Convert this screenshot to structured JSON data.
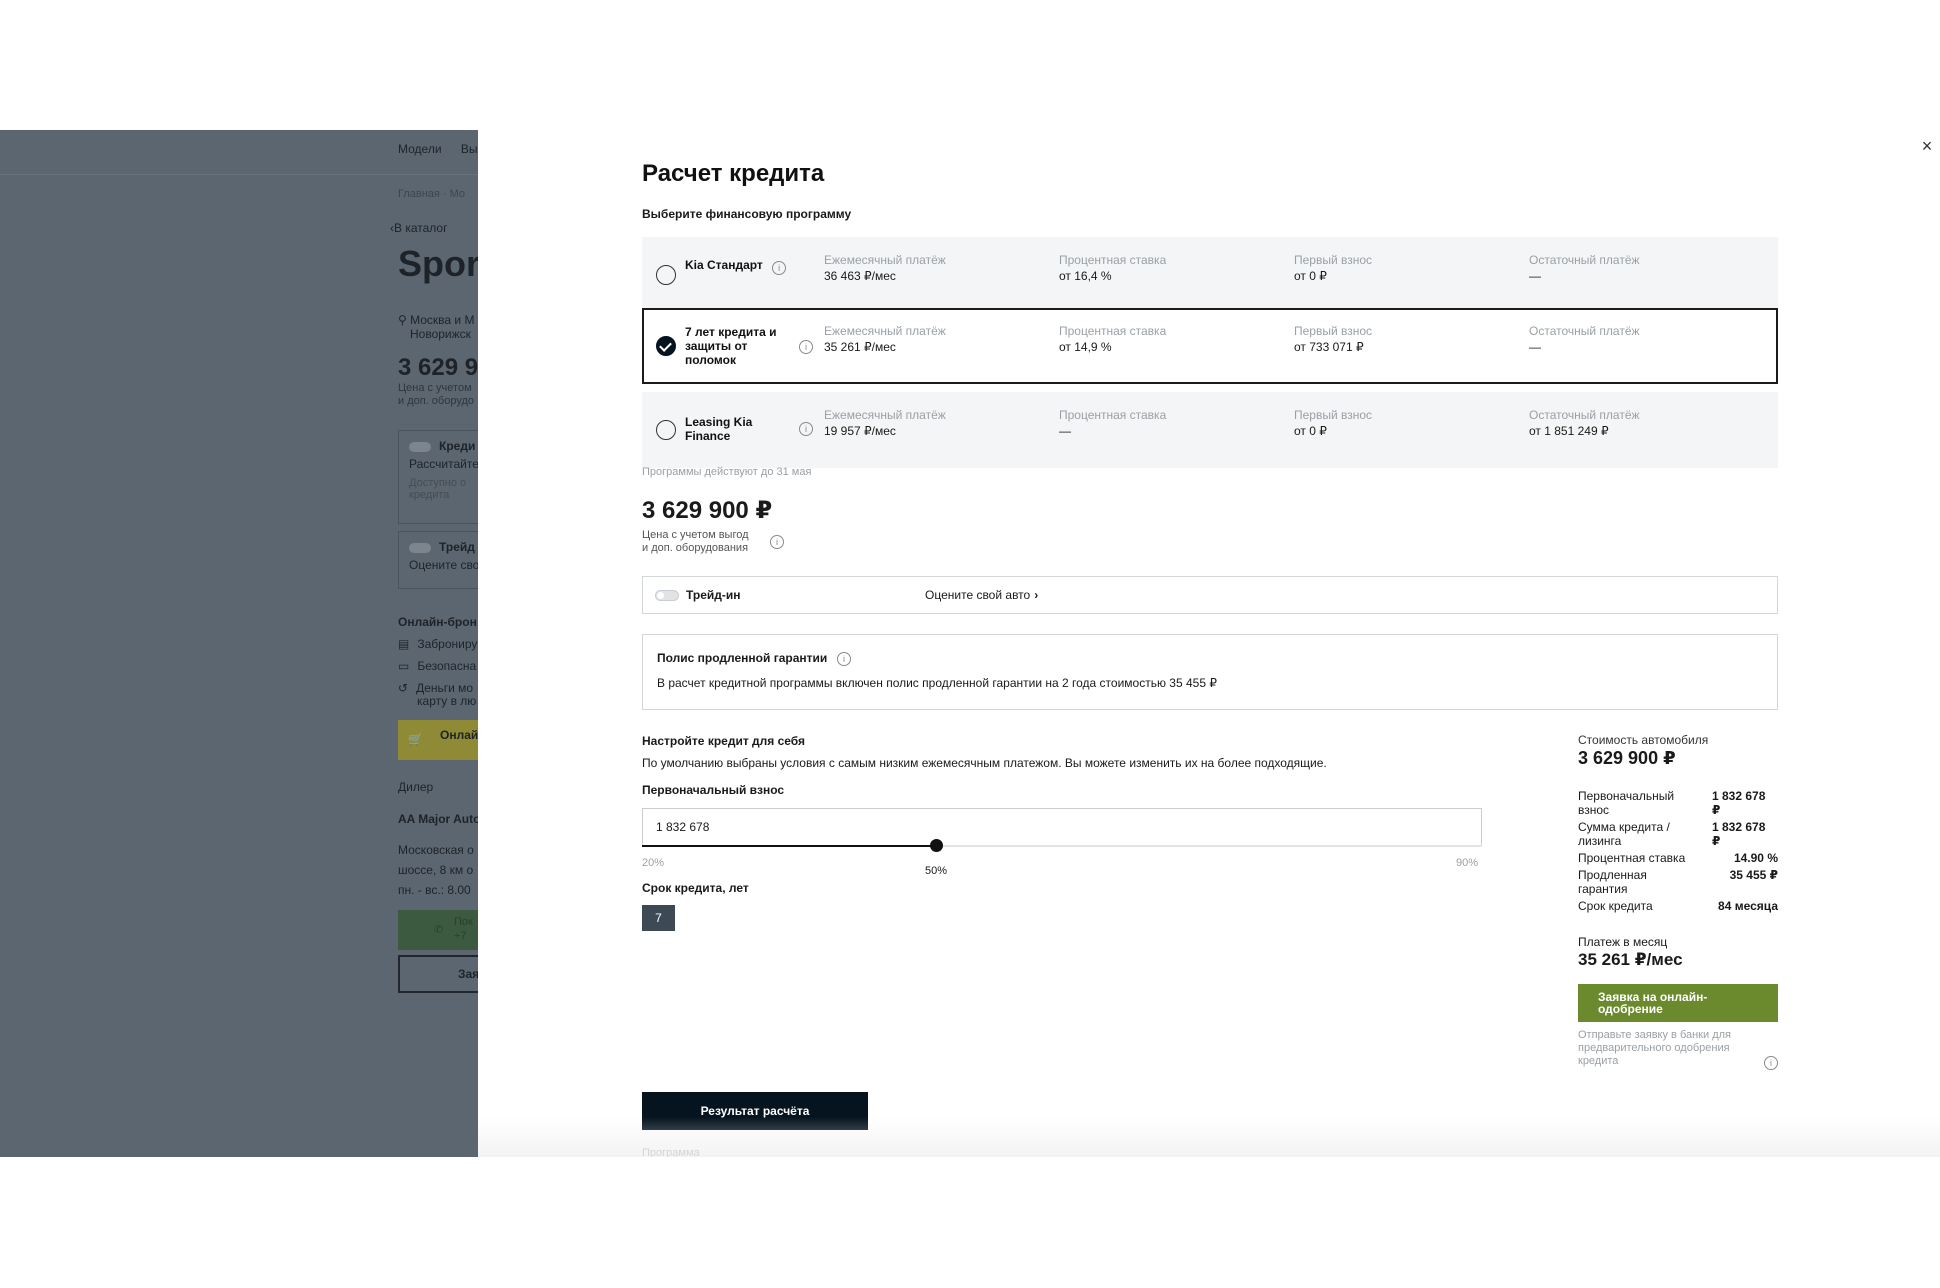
{
  "background_page": {
    "nav": [
      "Модели",
      "Вы"
    ],
    "breadcrumb": "Главная · Мо",
    "back_link": "В каталог",
    "model_name": "Sport",
    "location": [
      "Москва и М",
      "Новорижск"
    ],
    "price": "3 629 9",
    "price_note": [
      "Цена с учетом",
      "и доп. оборудо"
    ],
    "credit_card": {
      "title": "Креди",
      "subtitle": "Рассчитайте",
      "note": [
        "Доступно о",
        "кредита"
      ]
    },
    "tradein_card": {
      "title": "Трейд",
      "subtitle": "Оцените сво"
    },
    "online_booking": {
      "title": "Онлайн-брон",
      "items": [
        {
          "icon": "lock-icon",
          "text": [
            "Заброниру"
          ]
        },
        {
          "icon": "card-icon",
          "text": [
            "Безопасна"
          ]
        },
        {
          "icon": "refund-icon",
          "text": [
            "Деньги мо",
            "карту в лю"
          ]
        }
      ],
      "button": "Онлай"
    },
    "dealer": {
      "heading": "Дилер",
      "name": "AA Major Auto",
      "address": [
        "Московская о",
        "шоссе, 8 км о",
        "пн. - вс.: 8.00"
      ]
    },
    "call_button": [
      "Пок",
      "+7"
    ],
    "request_button": "Зая"
  },
  "modal": {
    "title": "Расчет кредита",
    "subtitle": "Выберите финансовую программу",
    "close_icon": "×",
    "info_glyph": "i",
    "programs": [
      {
        "name": [
          "Kia Стандарт"
        ],
        "selected": false,
        "cols": [
          {
            "label": "Ежемесячный платёж",
            "value": "36 463 ₽/мес"
          },
          {
            "label": "Процентная ставка",
            "value": "от 16,4 %"
          },
          {
            "label": "Первый взнос",
            "value": "от 0 ₽"
          },
          {
            "label": "Остаточный платёж",
            "value": "—"
          }
        ]
      },
      {
        "name": [
          "7 лет кредита и",
          "защиты от",
          "поломок"
        ],
        "selected": true,
        "cols": [
          {
            "label": "Ежемесячный платёж",
            "value": "35 261 ₽/мес"
          },
          {
            "label": "Процентная ставка",
            "value": "от 14,9 %"
          },
          {
            "label": "Первый взнос",
            "value": "от 733 071 ₽"
          },
          {
            "label": "Остаточный платёж",
            "value": "—"
          }
        ]
      },
      {
        "name": [
          "Leasing Kia",
          "Finance"
        ],
        "selected": false,
        "cols": [
          {
            "label": "Ежемесячный платёж",
            "value": "19 957 ₽/мес"
          },
          {
            "label": "Процентная ставка",
            "value": "—"
          },
          {
            "label": "Первый взнос",
            "value": "от 0 ₽"
          },
          {
            "label": "Остаточный платёж",
            "value": "от 1 851 249 ₽"
          }
        ]
      }
    ],
    "validity_note": "Программы действуют до 31 мая",
    "price": "3 629 900 ₽",
    "price_note": [
      "Цена с учетом выгод",
      "и доп. оборудования"
    ],
    "tradein": {
      "label": "Трейд-ин",
      "link": "Оцените свой авто",
      "enabled": false
    },
    "warranty": {
      "title": "Полис продленной гарантии",
      "text": "В расчет кредитной программы включен полис продленной гарантии на 2 года стоимостью 35 455 ₽"
    },
    "configure": {
      "title": "Настройте кредит для себя",
      "description": "По умолчанию выбраны условия с самым низким ежемесячным платежом. Вы можете изменить их на более подходящие.",
      "down_payment_label": "Первоначальный взнос",
      "down_payment_value": "1 832 678",
      "slider": {
        "min": 20,
        "max": 90,
        "value": 50,
        "min_label": "20%",
        "max_label": "90%",
        "value_label": "50%"
      },
      "term_label": "Срок кредита, лет",
      "term_value": "7"
    },
    "summary": {
      "cost_label": "Стоимость автомобиля",
      "cost": "3 629 900 ₽",
      "rows": [
        {
          "key": [
            "Первоначальный",
            "взнос"
          ],
          "value": [
            "1 832 678",
            "₽"
          ]
        },
        {
          "key": [
            "Сумма кредита /",
            "лизинга"
          ],
          "value": [
            "1 832 678",
            "₽"
          ]
        },
        {
          "key": [
            "Процентная ставка"
          ],
          "value": [
            "14.90 %"
          ]
        },
        {
          "key": [
            "Продленная гарантия"
          ],
          "value": [
            "35 455 ₽"
          ]
        },
        {
          "key": [
            "Срок кредита"
          ],
          "value": [
            "84 месяца"
          ]
        }
      ],
      "payment_label": "Платеж в месяц",
      "payment": "35 261 ₽/мес"
    },
    "approve_button": [
      "Заявка на онлайн-",
      "одобрение"
    ],
    "approve_note": [
      "Отправьте заявку в банки для",
      "предварительного одобрения",
      "кредита"
    ],
    "result_button": "Результат расчёта",
    "cut_text": "Программа"
  }
}
